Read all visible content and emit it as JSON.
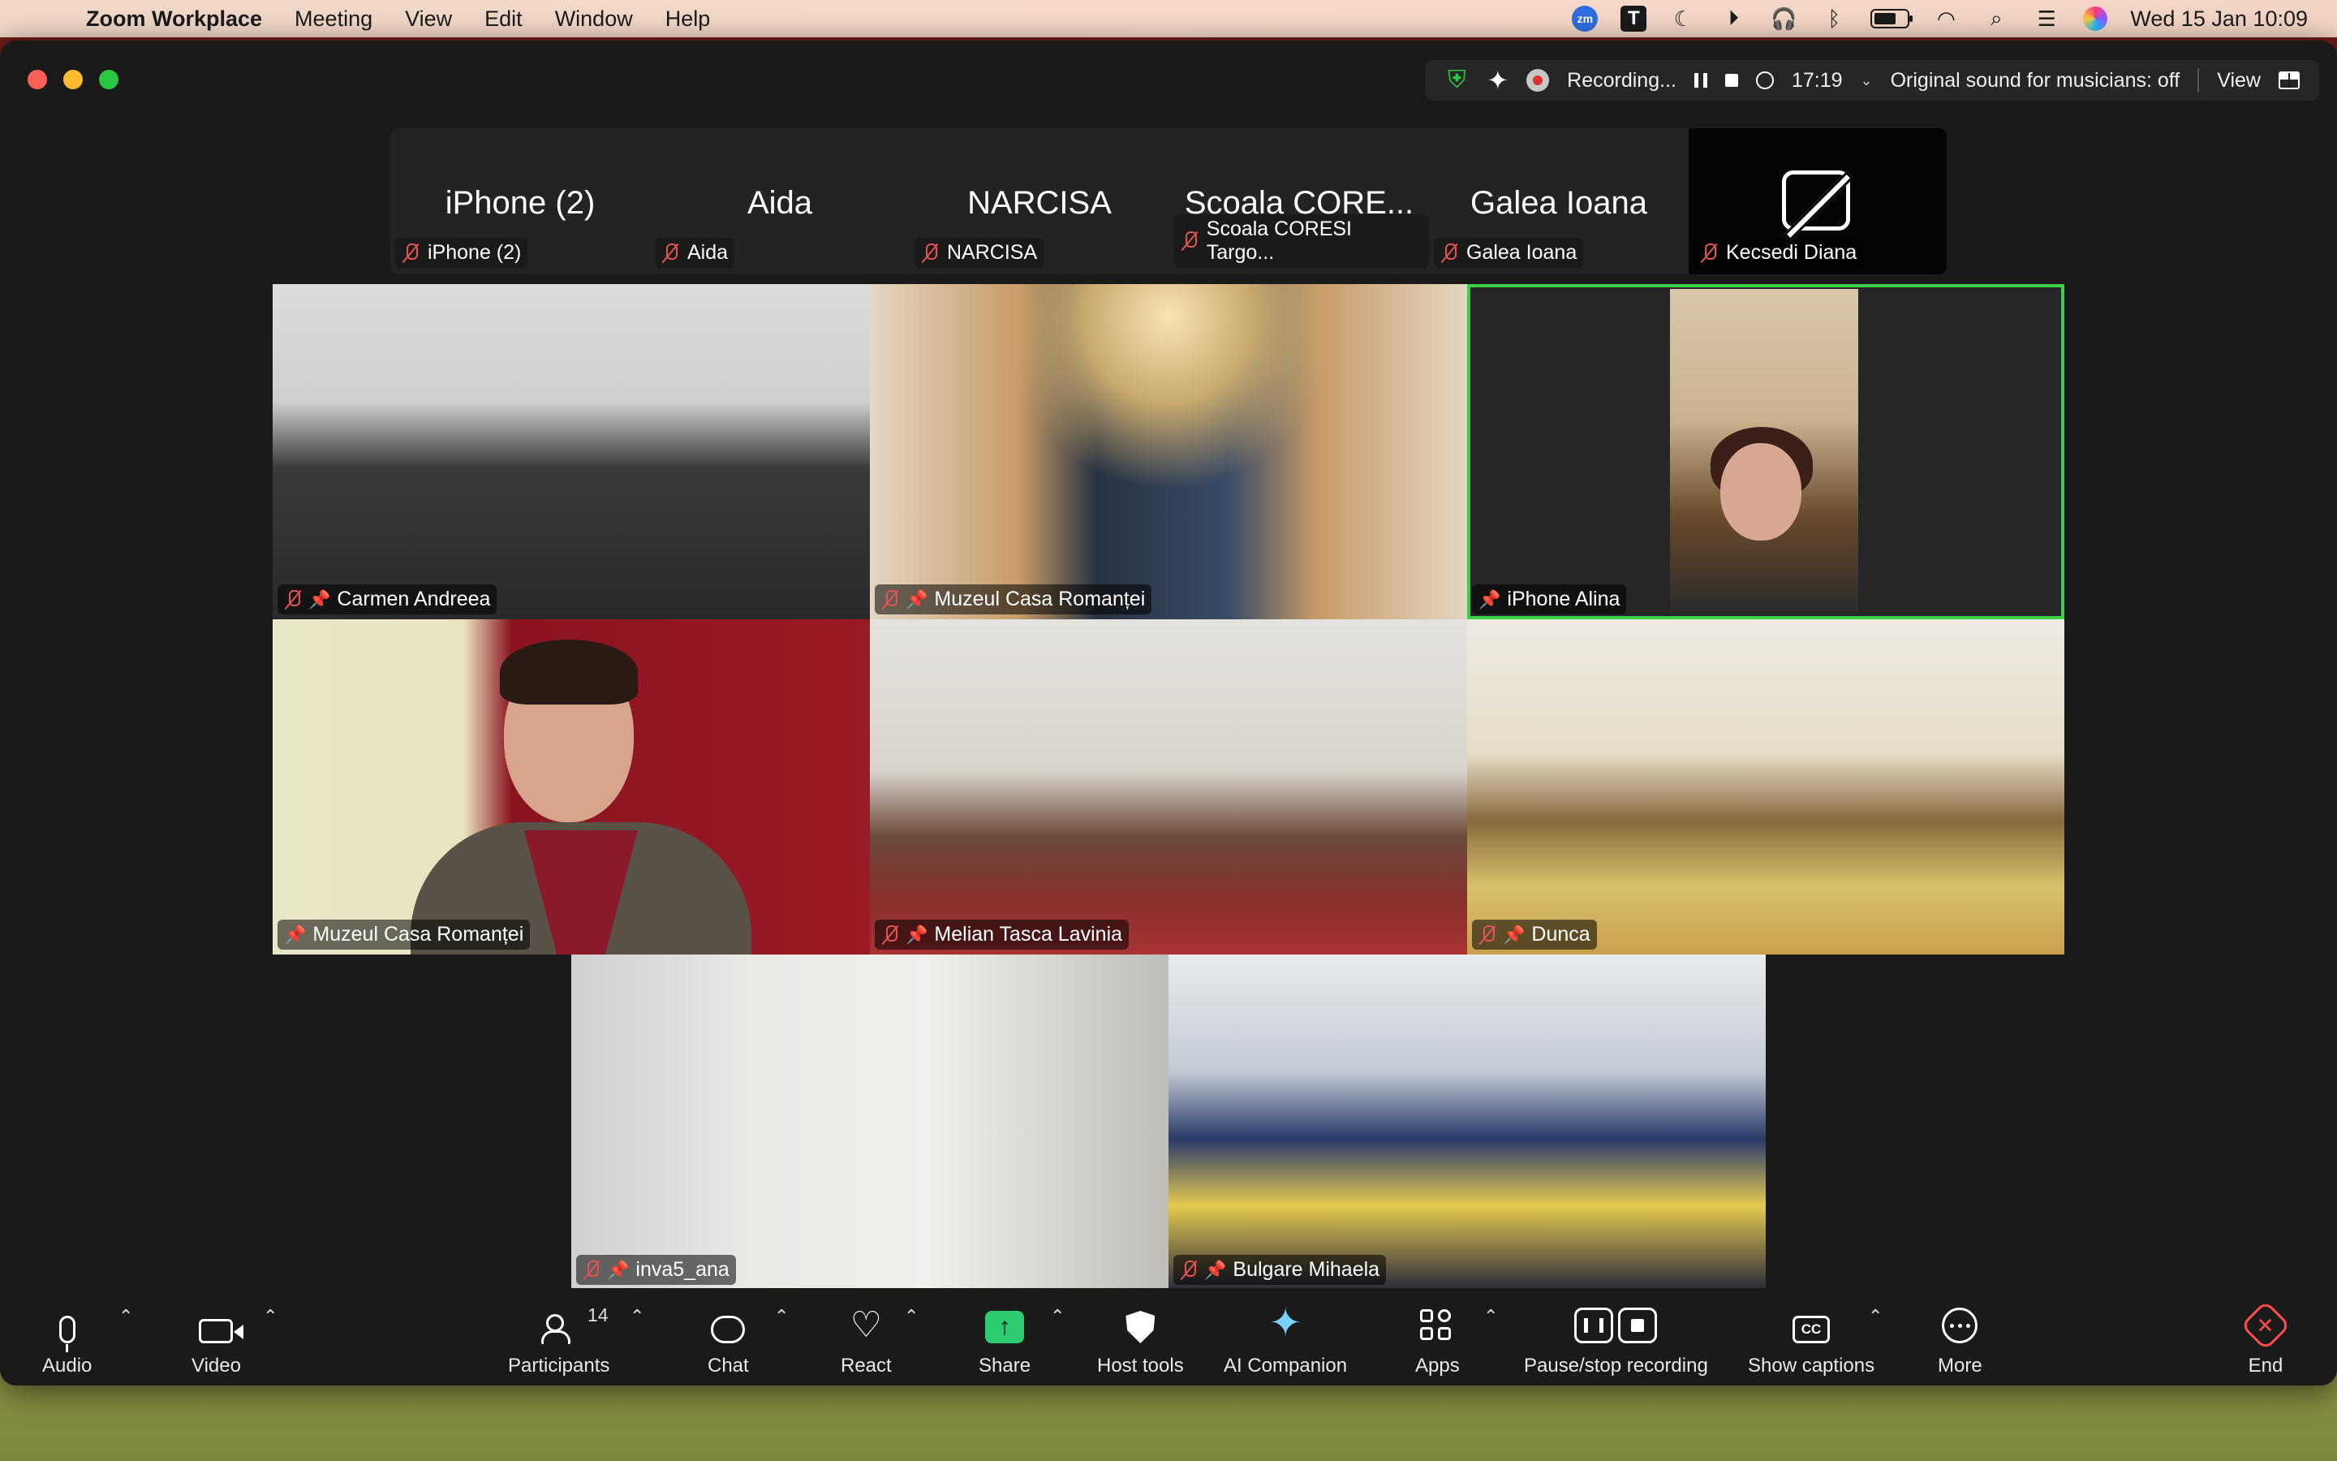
{
  "menubar": {
    "app_name": "Zoom Workplace",
    "menus": [
      "Meeting",
      "View",
      "Edit",
      "Window",
      "Help"
    ],
    "clock": "Wed 15 Jan  10:09",
    "zm_badge": "zm",
    "t_badge": "T"
  },
  "status": {
    "recording_label": "Recording...",
    "timer": "17:19",
    "original_sound": "Original sound for musicians: off",
    "view_label": "View"
  },
  "strip": [
    {
      "big": "iPhone (2)",
      "label": "iPhone (2)"
    },
    {
      "big": "Aida",
      "label": "Aida"
    },
    {
      "big": "NARCISA",
      "label": "NARCISA"
    },
    {
      "big": "Scoala CORE...",
      "label": "Scoala CORESI Targo..."
    },
    {
      "big": "Galea Ioana",
      "label": "Galea Ioana"
    },
    {
      "big": "",
      "label": "Kecsedi Diana"
    }
  ],
  "gallery": [
    {
      "name": "Carmen Andreea"
    },
    {
      "name": "Muzeul Casa Romanței"
    },
    {
      "name": "iPhone Alina"
    },
    {
      "name": "Muzeul Casa Romanței"
    },
    {
      "name": "Melian Tasca Lavinia"
    },
    {
      "name": "Dunca"
    },
    {
      "name": "inva5_ana"
    },
    {
      "name": "Bulgare Mihaela"
    }
  ],
  "toolbar": {
    "audio": "Audio",
    "video": "Video",
    "participants": "Participants",
    "participants_count": "14",
    "chat": "Chat",
    "react": "React",
    "share": "Share",
    "host_tools": "Host tools",
    "ai_companion": "AI Companion",
    "apps": "Apps",
    "pause_stop": "Pause/stop recording",
    "captions": "Show captions",
    "captions_badge": "CC",
    "more": "More",
    "end": "End"
  },
  "colors": {
    "speaking_outline": "#3ad04a",
    "share_green": "#2ecc71",
    "end_red": "#ff4d4f",
    "muted_red": "#e55353"
  }
}
